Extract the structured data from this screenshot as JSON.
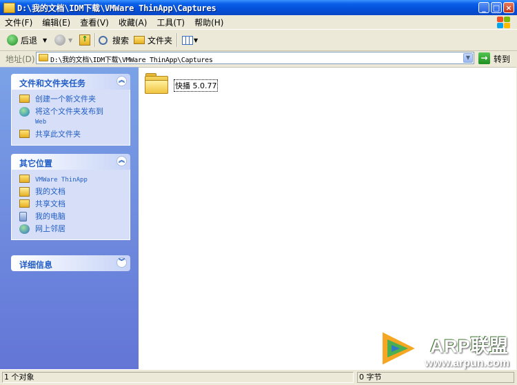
{
  "window": {
    "title": "D:\\我的文档\\IDM下载\\VMWare ThinApp\\Captures",
    "buttons": {
      "minimize": "_",
      "maximize": "□",
      "close": "×"
    }
  },
  "menu": [
    "文件(F)",
    "编辑(E)",
    "查看(V)",
    "收藏(A)",
    "工具(T)",
    "帮助(H)"
  ],
  "toolbar": {
    "back_label": "后退",
    "search_label": "搜索",
    "folders_label": "文件夹"
  },
  "address": {
    "label": "地址(D)",
    "path": "D:\\我的文档\\IDM下载\\VMWare ThinApp\\Captures",
    "go_label": "转到"
  },
  "tasks_panel": {
    "title": "文件和文件夹任务",
    "items": [
      "创建一个新文件夹",
      "将这个文件夹发布到",
      "Web",
      "共享此文件夹"
    ]
  },
  "places_panel": {
    "title": "其它位置",
    "items": [
      "VMWare ThinApp",
      "我的文档",
      "共享文档",
      "我的电脑",
      "网上邻居"
    ]
  },
  "details_panel": {
    "title": "详细信息"
  },
  "files": [
    {
      "name": "快播 5.0.77",
      "icon": "folder-icon"
    }
  ],
  "status": {
    "left": "1 个对象",
    "right": "0 字节"
  },
  "watermark": {
    "brand": "ARP联盟",
    "site": "www.arpun.com",
    "colors": [
      "#F5A623",
      "#4CAF50",
      "#2E7BC4"
    ]
  }
}
